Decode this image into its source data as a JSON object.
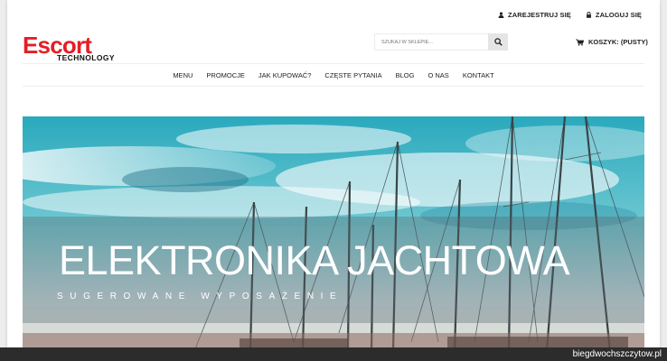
{
  "header": {
    "register_label": "ZAREJESTRUJ SIĘ",
    "login_label": "ZALOGUJ SIĘ",
    "logo_text_main": "Escort",
    "logo_text_sub": "TECHNOLOGY",
    "search_placeholder": "SZUKAJ W SKLEPIE...",
    "cart_label": "KOSZYK: (PUSTY)"
  },
  "nav": {
    "items": [
      "MENU",
      "PROMOCJE",
      "JAK KUPOWAĆ?",
      "CZĘSTE PYTANIA",
      "BLOG",
      "O NAS",
      "KONTAKT"
    ]
  },
  "hero": {
    "title": "ELEKTRONIKA JACHTOWA",
    "subtitle": "SUGEROWANE WYPOSAŻENIE"
  },
  "watermark": "biegdwochszczytow.pl",
  "colors": {
    "logo_red": "#e41e26",
    "sky_teal": "#2fb7c8",
    "text_dark": "#222222"
  },
  "icons": {
    "register": "user-icon",
    "login": "lock-icon",
    "search": "search-icon",
    "cart": "cart-icon"
  }
}
